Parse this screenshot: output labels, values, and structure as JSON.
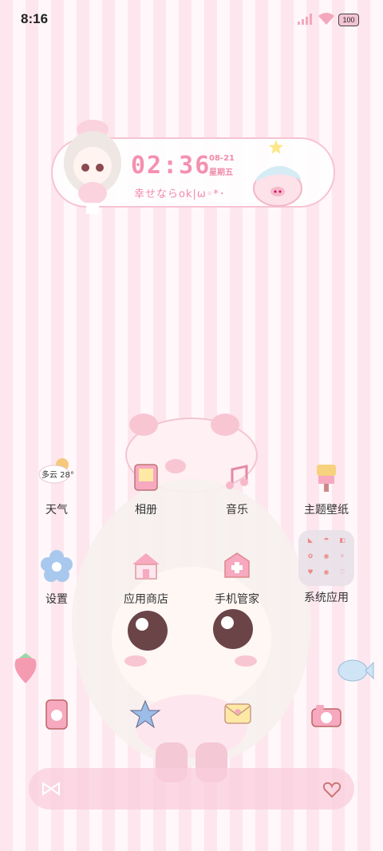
{
  "status_bar": {
    "time": "8:16",
    "battery": "100"
  },
  "widget": {
    "time": "02:36",
    "date": "08-21",
    "weekday": "星期五",
    "text": "幸せならok|ω◦*･"
  },
  "weather": {
    "condition_temp": "多云 28°"
  },
  "apps_row1": [
    {
      "label": "天气",
      "icon": "weather-icon"
    },
    {
      "label": "相册",
      "icon": "gallery-icon"
    },
    {
      "label": "音乐",
      "icon": "music-icon"
    },
    {
      "label": "主题壁纸",
      "icon": "theme-icon"
    }
  ],
  "apps_row2": [
    {
      "label": "设置",
      "icon": "settings-icon"
    },
    {
      "label": "应用商店",
      "icon": "app-store-icon"
    },
    {
      "label": "手机管家",
      "icon": "phone-manager-icon"
    },
    {
      "label": "系统应用",
      "icon": "system-apps-folder-icon"
    }
  ],
  "dock_apps": [
    "phone-icon",
    "contacts-icon",
    "messages-icon",
    "camera-icon"
  ],
  "colors": {
    "accent": "#f490b0",
    "stripe": "#fde6ee"
  }
}
